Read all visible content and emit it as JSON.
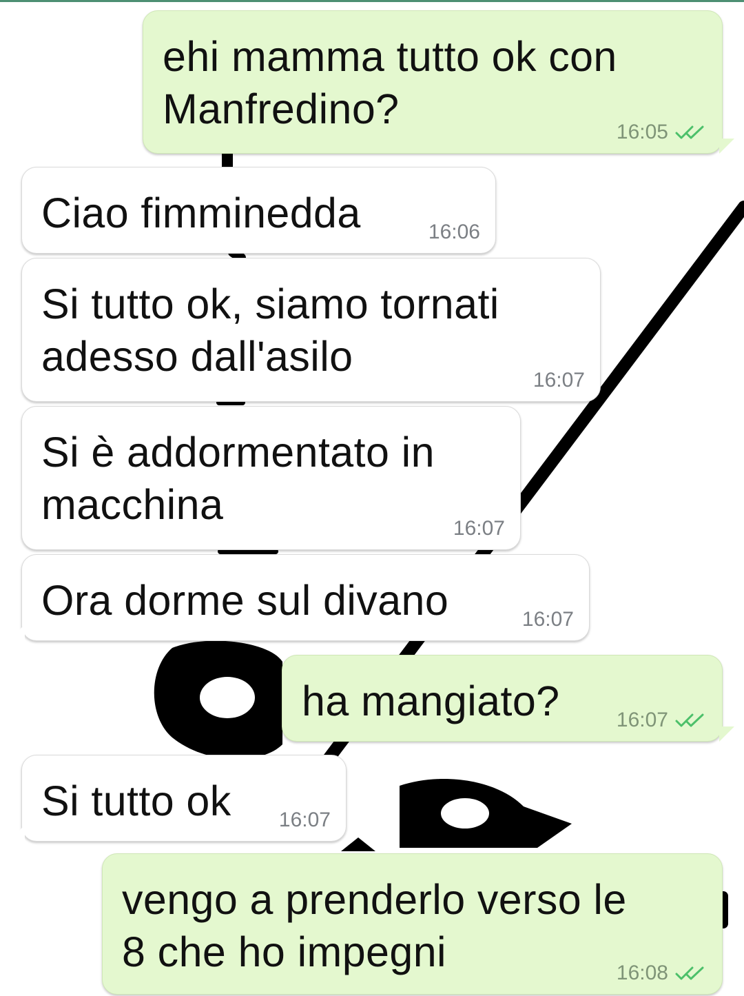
{
  "chat": {
    "messages": [
      {
        "direction": "outgoing",
        "text": "ehi mamma tutto ok con\nManfredino?",
        "time": "16:05",
        "status_icon": "double-check-icon"
      },
      {
        "direction": "incoming",
        "text": "Ciao fimminedda",
        "time": "16:06"
      },
      {
        "direction": "incoming",
        "text": "Si tutto ok, siamo tornati\nadesso dall'asilo",
        "time": "16:07"
      },
      {
        "direction": "incoming",
        "text": "Si è addormentato in\nmacchina",
        "time": "16:07"
      },
      {
        "direction": "incoming",
        "text": "Ora dorme sul divano",
        "time": "16:07"
      },
      {
        "direction": "outgoing",
        "text": "ha mangiato?",
        "time": "16:07",
        "status_icon": "double-check-icon"
      },
      {
        "direction": "incoming",
        "text": "Si tutto ok",
        "time": "16:07"
      },
      {
        "direction": "outgoing",
        "text": "vengo a prenderlo verso le\n8 che ho impegni",
        "time": "16:08",
        "status_icon": "double-check-icon"
      }
    ]
  },
  "colors": {
    "incoming_bubble": "#ffffff",
    "outgoing_bubble": "#e4f8cf",
    "read_ticks": "#4cc06a",
    "wallpaper_pattern": "#000000"
  }
}
